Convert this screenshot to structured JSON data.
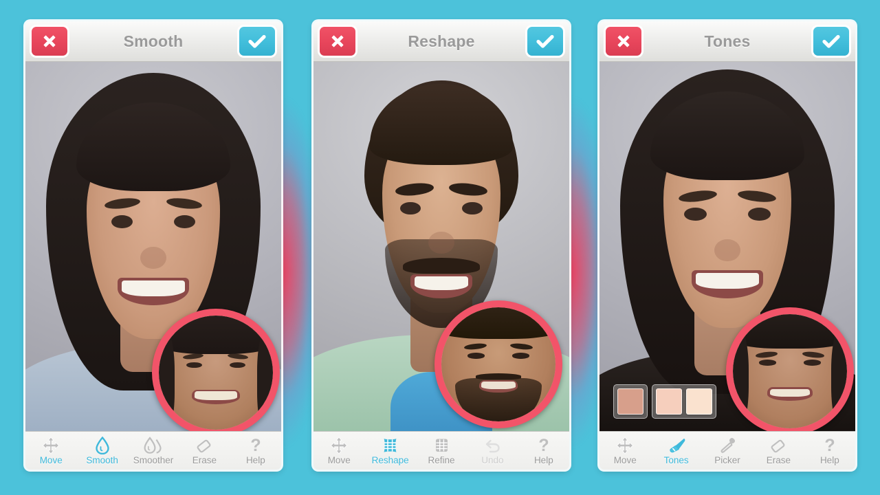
{
  "app": {
    "background_color": "#4cc2da",
    "accent_blue": "#3fb9db",
    "accent_red": "#e8465c",
    "loupe_ring_color": "#f25469"
  },
  "panels": [
    {
      "id": "smooth",
      "header": {
        "title": "Smooth",
        "cancel_label": "Cancel",
        "cancel_icon": "close-x-icon",
        "confirm_label": "Apply",
        "confirm_icon": "checkmark-icon"
      },
      "loupe": {
        "label": "before-preview-loupe"
      },
      "toolbar": [
        {
          "label": "Move",
          "icon": "move-arrows-icon",
          "state": "normal"
        },
        {
          "label": "Smooth",
          "icon": "droplet-icon",
          "state": "active"
        },
        {
          "label": "Smoother",
          "icon": "double-droplet-icon",
          "state": "normal"
        },
        {
          "label": "Erase",
          "icon": "eraser-icon",
          "state": "normal"
        },
        {
          "label": "Help",
          "icon": "question-mark-icon",
          "state": "normal"
        }
      ]
    },
    {
      "id": "reshape",
      "header": {
        "title": "Reshape",
        "cancel_label": "Cancel",
        "cancel_icon": "close-x-icon",
        "confirm_label": "Apply",
        "confirm_icon": "checkmark-icon"
      },
      "loupe": {
        "label": "before-preview-loupe"
      },
      "toolbar": [
        {
          "label": "Move",
          "icon": "move-arrows-icon",
          "state": "normal"
        },
        {
          "label": "Reshape",
          "icon": "warp-grid-icon",
          "state": "active"
        },
        {
          "label": "Refine",
          "icon": "fine-grid-icon",
          "state": "normal"
        },
        {
          "label": "Undo",
          "icon": "undo-icon",
          "state": "disabled"
        },
        {
          "label": "Help",
          "icon": "question-mark-icon",
          "state": "normal"
        }
      ]
    },
    {
      "id": "tones",
      "header": {
        "title": "Tones",
        "cancel_label": "Cancel",
        "cancel_icon": "close-x-icon",
        "confirm_label": "Apply",
        "confirm_icon": "checkmark-icon"
      },
      "loupe": {
        "label": "before-preview-loupe"
      },
      "swatch_groups": [
        {
          "swatches": [
            {
              "color": "#d79f8b"
            }
          ]
        },
        {
          "swatches": [
            {
              "color": "#f6cfbd"
            },
            {
              "color": "#fae2cf"
            }
          ]
        }
      ],
      "toolbar": [
        {
          "label": "Move",
          "icon": "move-arrows-icon",
          "state": "normal"
        },
        {
          "label": "Tones",
          "icon": "brush-icon",
          "state": "active"
        },
        {
          "label": "Picker",
          "icon": "eyedropper-icon",
          "state": "normal"
        },
        {
          "label": "Erase",
          "icon": "eraser-icon",
          "state": "normal"
        },
        {
          "label": "Help",
          "icon": "question-mark-icon",
          "state": "normal"
        }
      ]
    }
  ]
}
